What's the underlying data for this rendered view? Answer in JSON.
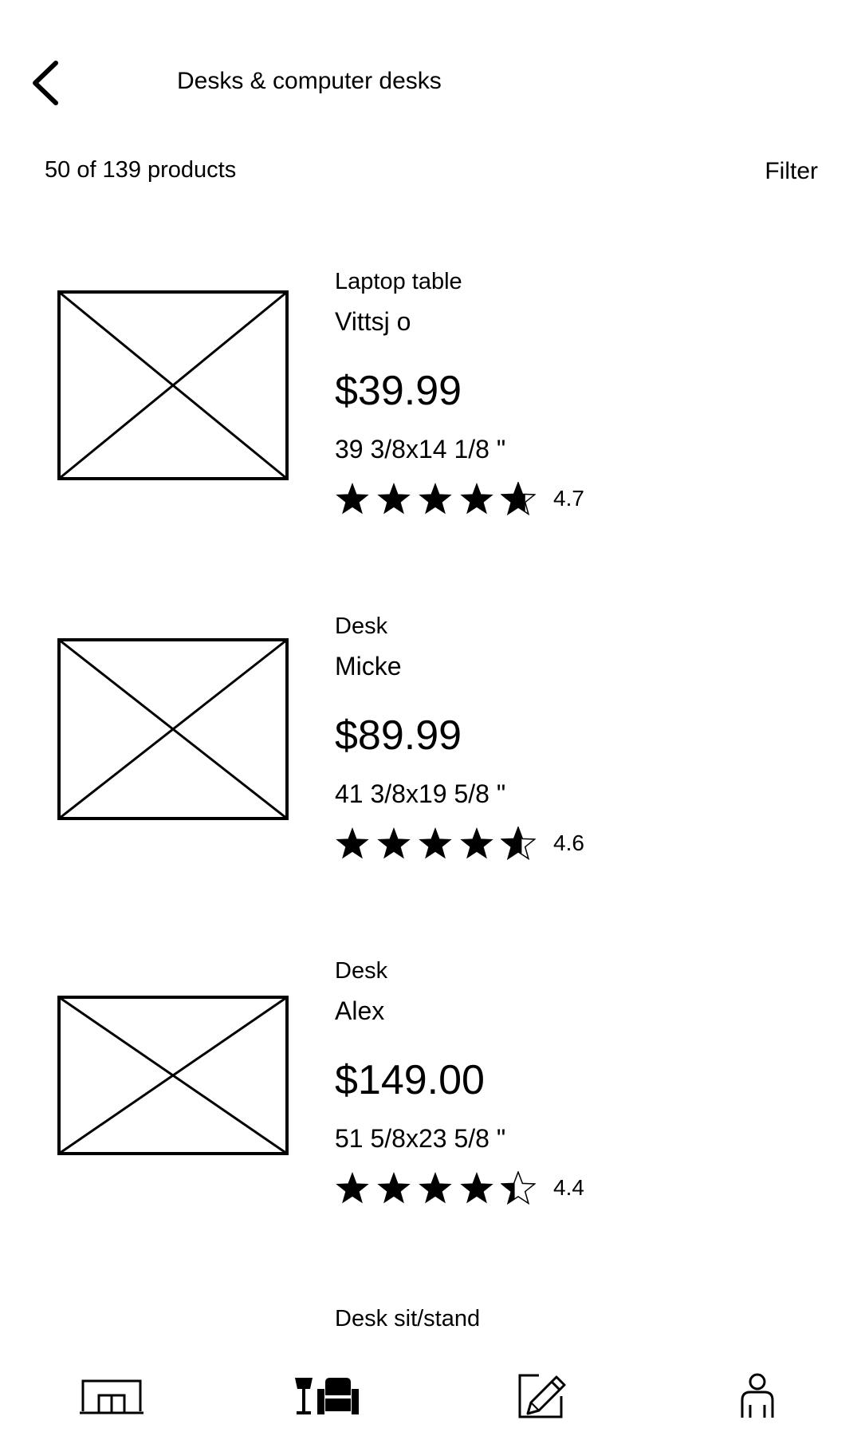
{
  "header": {
    "back_icon": "chevron-left-icon",
    "title": "Desks & computer desks"
  },
  "toolbar": {
    "count_text": "50 of 139 products",
    "filter_label": "Filter"
  },
  "products": [
    {
      "image_icon": "image-placeholder-icon",
      "category": "Laptop table",
      "name": "Vittsj o",
      "price": "$39.99",
      "dimensions": "39 3/8x14 1/8 \"",
      "rating": 4.7,
      "rating_text": "4.7"
    },
    {
      "image_icon": "image-placeholder-icon",
      "category": "Desk",
      "name": "Micke",
      "price": "$89.99",
      "dimensions": "41 3/8x19 5/8 \"",
      "rating": 4.6,
      "rating_text": "4.6"
    },
    {
      "image_icon": "image-placeholder-icon",
      "category": "Desk",
      "name": "Alex",
      "price": "$149.00",
      "dimensions": "51 5/8x23 5/8 \"",
      "rating": 4.4,
      "rating_text": "4.4"
    }
  ],
  "partial_product": {
    "category": "Desk sit/stand"
  },
  "bottom_nav": {
    "items": [
      {
        "icon": "rooms-icon"
      },
      {
        "icon": "furniture-icon"
      },
      {
        "icon": "design-pencil-icon"
      },
      {
        "icon": "profile-icon"
      }
    ]
  },
  "colors": {
    "text": "#000000",
    "background": "#ffffff",
    "star": "#000000"
  }
}
